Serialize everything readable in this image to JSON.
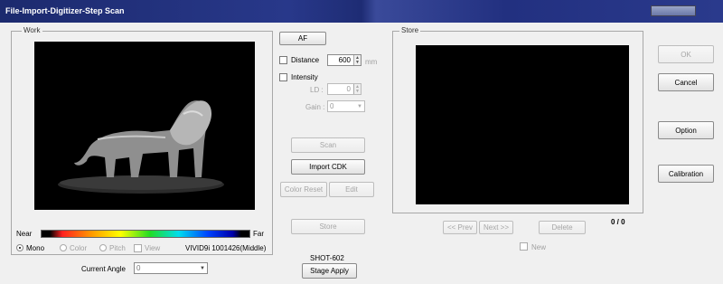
{
  "window": {
    "title": "File-Import-Digitizer-Step Scan"
  },
  "work": {
    "label": "Work",
    "colorbar": {
      "near": "Near",
      "far": "Far"
    },
    "modes": [
      {
        "label": "Mono",
        "selected": true
      },
      {
        "label": "Color",
        "selected": false
      },
      {
        "label": "Pitch",
        "selected": false
      }
    ],
    "view_label": "View",
    "device_info": "VIVID9i 1001426(Middle)",
    "current_angle": {
      "label": "Current Angle",
      "value": "0"
    }
  },
  "controls": {
    "af": "AF",
    "distance": {
      "label": "Distance",
      "value": "600",
      "unit": "mm"
    },
    "intensity": {
      "label": "Intensity"
    },
    "ld": {
      "label": "LD :",
      "value": "0"
    },
    "gain": {
      "label": "Gain :",
      "value": "0"
    },
    "scan": "Scan",
    "import_cdk": "Import CDK",
    "color_reset": "Color Reset",
    "edit": "Edit",
    "store": "Store",
    "stage_name": "SHOT-602",
    "stage_apply": "Stage Apply"
  },
  "store": {
    "label": "Store",
    "prev": "<< Prev",
    "next": "Next >>",
    "delete": "Delete",
    "counter": "0 / 0",
    "new_label": "New"
  },
  "side": {
    "ok": "OK",
    "cancel": "Cancel",
    "option": "Option",
    "calibration": "Calibration"
  }
}
